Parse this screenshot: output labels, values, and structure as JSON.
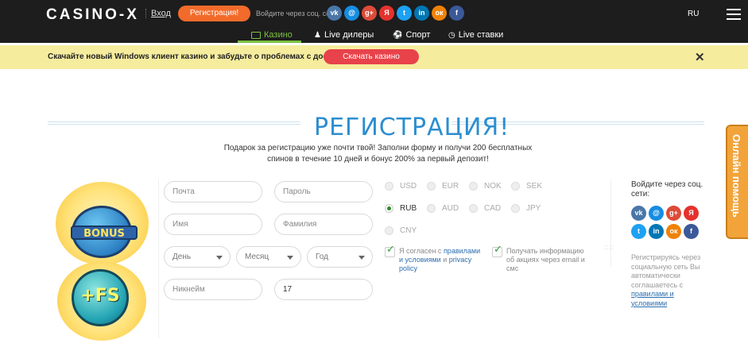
{
  "header": {
    "logo": "CASINO-X",
    "login": "Вход",
    "register": "Регистрация!",
    "social_label": "Войдите через соц. сети:",
    "lang": "RU",
    "social": [
      {
        "icon": "vk-icon",
        "glyph": "vk",
        "color": "#4a76a8"
      },
      {
        "icon": "mail-icon",
        "glyph": "@",
        "color": "#168de2"
      },
      {
        "icon": "google-plus-icon",
        "glyph": "g+",
        "color": "#dd4b39"
      },
      {
        "icon": "yandex-icon",
        "glyph": "Я",
        "color": "#e5322d"
      },
      {
        "icon": "twitter-icon",
        "glyph": "t",
        "color": "#1da1f2"
      },
      {
        "icon": "linkedin-icon",
        "glyph": "in",
        "color": "#0077b5"
      },
      {
        "icon": "odnoklassniki-icon",
        "glyph": "ок",
        "color": "#ee8208"
      },
      {
        "icon": "facebook-icon",
        "glyph": "f",
        "color": "#3b5998"
      }
    ]
  },
  "nav": {
    "tabs": [
      {
        "label": "Казино",
        "icon": "casino-icon",
        "active": true
      },
      {
        "label": "Live дилеры",
        "icon": "dealer-icon",
        "active": false
      },
      {
        "label": "Спорт",
        "icon": "ball-icon",
        "active": false
      },
      {
        "label": "Live ставки",
        "icon": "clock-icon",
        "active": false
      }
    ],
    "accent": "#7cc142"
  },
  "banner": {
    "text": "Скачайте новый Windows клиент казино и забудьте о проблемах с доступом",
    "button": "Скачать казино",
    "close": "✕"
  },
  "registration": {
    "title": "РЕГИСТРАЦИЯ!",
    "description": "Подарок за регистрацию уже почти твой! Заполни форму и получи 200 бесплатных спинов в течение 10 дней и бонус 200% за первый депозит!",
    "art": {
      "bonus": "BONUS",
      "fs": "+FS"
    },
    "fields": {
      "email": "Почта",
      "password": "Пароль",
      "first_name": "Имя",
      "last_name": "Фамилия",
      "day": "День",
      "month": "Месяц",
      "year": "Год",
      "nickname": "Никнейм",
      "promo_value": "17"
    },
    "currencies": [
      "USD",
      "EUR",
      "NOK",
      "SEK",
      "RUB",
      "AUD",
      "CAD",
      "JPY",
      "CNY"
    ],
    "selected_currency": "RUB",
    "agree": {
      "prefix": "Я согласен с ",
      "rules": "правилами и условиями",
      "and": " и ",
      "privacy": "privacy policy"
    },
    "news": "Получать информацию об акциях через email и смс",
    "dots": "::::",
    "social_title": "Войдите через соц. сети:",
    "social_note": "Регистрируясь через социальную сеть Вы автоматически соглашаетесь с",
    "social_note_link": "правилами и условиями"
  },
  "help": "Онлайн помощь"
}
